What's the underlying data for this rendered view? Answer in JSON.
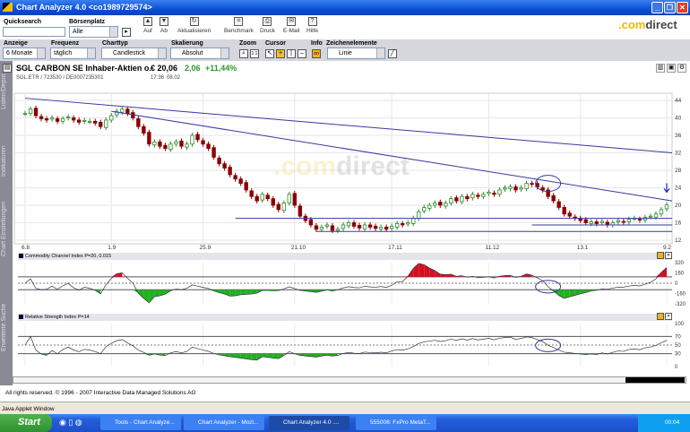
{
  "window": {
    "title": "Chart Analyzer 4.0  <co1989729574>"
  },
  "toolbar": {
    "quicksearch_label": "Quicksearch",
    "quicksearch_value": "",
    "boersenplatz_label": "Börsenplatz",
    "boersenplatz_value": "Alle",
    "buttons": [
      {
        "label": "Auf",
        "icon": "arrow-up-icon"
      },
      {
        "label": "Ab",
        "icon": "arrow-down-icon"
      },
      {
        "label": "Aktualisieren",
        "icon": "refresh-icon"
      },
      {
        "label": "Benchmark",
        "icon": "benchmark-icon"
      },
      {
        "label": "Druck",
        "icon": "print-icon"
      },
      {
        "label": "E-Mail",
        "icon": "mail-icon"
      },
      {
        "label": "Hilfe",
        "icon": "help-icon"
      }
    ],
    "brand_com": ".com",
    "brand_direct": "direct"
  },
  "settings": {
    "anzeige_label": "Anzeige",
    "anzeige_value": "6 Monate",
    "frequenz_label": "Frequenz",
    "frequenz_value": "täglich",
    "charttyp_label": "Charttyp",
    "charttyp_value": "Candlestick",
    "skalierung_label": "Skalierung",
    "skalierung_value": "Absolut",
    "zoom_label": "Zoom",
    "zoom_reset": "1:1",
    "cursor_label": "Cursor",
    "info_label": "Info",
    "info_value": "on",
    "zeichen_label": "Zeichenelemente",
    "zeichen_value": "Linie"
  },
  "stock": {
    "name": "SGL CARBON SE Inhaber-Aktien o.",
    "ids": "SGL.ETR / 723530 / DE0007235301",
    "price": "€ 20,06",
    "change": "2,06",
    "change_pct": "+11,44%",
    "time": "17:36",
    "date": "08.02"
  },
  "left_tabs": [
    "Listen/Depot",
    "Indikatoren",
    "Chart Einstellungen",
    "Erweiterte Suche"
  ],
  "colors": {
    "up": "#2e8b2e",
    "down": "#8b0000",
    "trend": "#3838a0",
    "cci_pos": "#d01020",
    "cci_neg": "#20b020"
  },
  "chart_data": {
    "type": "candlestick",
    "y_ticks": [
      44,
      40,
      36,
      32,
      28,
      24,
      20,
      16,
      12
    ],
    "ylim": [
      12,
      44
    ],
    "x_ticks": [
      {
        "label": "6.8",
        "i": 0
      },
      {
        "label": "1.9",
        "i": 16
      },
      {
        "label": "25.9",
        "i": 33
      },
      {
        "label": "21.10",
        "i": 50
      },
      {
        "label": "17.11",
        "i": 68
      },
      {
        "label": "11.12",
        "i": 86
      },
      {
        "label": "13.1",
        "i": 103
      },
      {
        "label": "9.2",
        "i": 119
      }
    ],
    "closes": [
      41,
      42,
      40.5,
      39.8,
      39.5,
      40,
      39.2,
      39.8,
      40.2,
      39.5,
      39,
      39.4,
      39.2,
      38.8,
      38,
      39.5,
      40.5,
      41.5,
      42,
      41,
      40,
      38,
      36.5,
      34,
      34.5,
      33.5,
      33,
      34,
      34.5,
      33.5,
      34,
      36,
      35,
      34,
      33,
      31,
      29.5,
      28.5,
      27,
      26,
      25,
      23.5,
      22,
      21,
      22.5,
      21.5,
      20,
      19,
      20.5,
      22.5,
      20,
      17.5,
      16.5,
      15.5,
      14.5,
      15,
      15.5,
      14.2,
      14.5,
      15.5,
      16,
      15.2,
      14.8,
      15.5,
      15,
      14.7,
      15,
      14.5,
      15.2,
      15.8,
      15.5,
      16,
      17,
      18.5,
      19.5,
      20,
      20.5,
      20,
      20.5,
      21.5,
      21,
      22,
      21.5,
      22.5,
      22,
      22.5,
      23,
      22.5,
      23.5,
      24,
      24.2,
      23.5,
      24,
      25,
      24.8,
      24.2,
      23.5,
      22,
      21,
      19.5,
      18,
      17.5,
      17,
      16.5,
      16,
      16.2,
      15.8,
      16.3,
      15.5,
      16,
      16.5,
      16.2,
      16.8,
      17,
      16.6,
      17.2,
      17.5,
      18,
      19,
      20.06
    ],
    "trendlines": [
      {
        "from": [
          0,
          44.5
        ],
        "to": [
          120,
          32
        ]
      },
      {
        "from": [
          16,
          41.5
        ],
        "to": [
          120,
          21
        ]
      },
      {
        "from": [
          39,
          17
        ],
        "to": [
          120,
          17
        ]
      },
      {
        "from": [
          54,
          14
        ],
        "to": [
          120,
          14
        ]
      },
      {
        "from": [
          94,
          15.5
        ],
        "to": [
          120,
          15.5
        ]
      }
    ],
    "circle": {
      "i": 97,
      "price": 25
    },
    "arrow": {
      "i": 119,
      "price": 23
    },
    "watermark_com": ".com",
    "watermark_direct": "direct"
  },
  "indicators": [
    {
      "title": "Commodity Channel Index P=20, 0.015",
      "ticks": [
        320,
        160,
        0,
        -160,
        -320
      ],
      "ylim": [
        -320,
        320
      ],
      "levels": [
        100,
        -100
      ]
    },
    {
      "title": "Relative Strength Index P=14",
      "ticks": [
        100,
        70,
        50,
        30,
        0
      ],
      "ylim": [
        0,
        100
      ],
      "levels": [
        70,
        30
      ]
    }
  ],
  "footer": {
    "copyright": "All rights reserved. © 1996 - 2007 Interactive Data Managed Solutions AG",
    "applet": "Java Applet Window"
  },
  "taskbar": {
    "start": "Start",
    "tasks": [
      "Tools - Chart Analyze...",
      "Chart Analyzer - Mozi...",
      "Chart Analyzer 4.0 ....",
      "555008: FxPro MetaT..."
    ],
    "clock": "00:04"
  }
}
